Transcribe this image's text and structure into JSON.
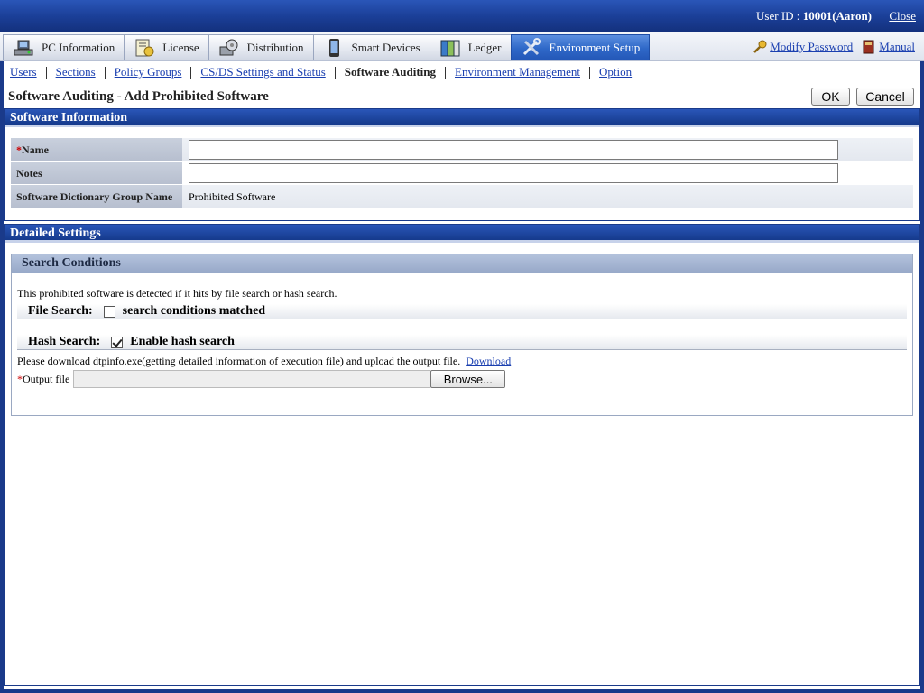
{
  "header": {
    "user_label": "User ID : ",
    "user_value": "10001(Aaron)",
    "close_label": "Close"
  },
  "tabs": [
    {
      "label": "PC Information",
      "icon": "pc-info-icon"
    },
    {
      "label": "License",
      "icon": "license-icon"
    },
    {
      "label": "Distribution",
      "icon": "distribution-icon"
    },
    {
      "label": "Smart Devices",
      "icon": "smart-device-icon"
    },
    {
      "label": "Ledger",
      "icon": "ledger-icon"
    },
    {
      "label": "Environment Setup",
      "icon": "tools-icon",
      "active": true
    }
  ],
  "top_links": {
    "modify_password": "Modify Password",
    "manual": "Manual"
  },
  "subnav": [
    {
      "label": "Users"
    },
    {
      "label": "Sections"
    },
    {
      "label": "Policy Groups"
    },
    {
      "label": "CS/DS Settings and Status"
    },
    {
      "label": "Software Auditing",
      "current": true
    },
    {
      "label": "Environment Management"
    },
    {
      "label": "Option"
    }
  ],
  "page": {
    "title": "Software Auditing - Add Prohibited Software",
    "ok_label": "OK",
    "cancel_label": "Cancel"
  },
  "software_info": {
    "heading": "Software Information",
    "name_required_mark": "*",
    "name_label": "Name",
    "name_value": "",
    "notes_label": "Notes",
    "notes_value": "",
    "group_label": "Software Dictionary Group Name",
    "group_value": "Prohibited Software"
  },
  "detailed": {
    "heading": "Detailed Settings",
    "search_heading": "Search Conditions",
    "description": "This prohibited software is detected if it hits by file search or hash search.",
    "file_search_label": "File Search:",
    "file_search_option": "search conditions matched",
    "file_search_checked": false,
    "hash_search_label": "Hash Search:",
    "hash_search_option": "Enable hash search",
    "hash_search_checked": true,
    "download_text": "Please download dtpinfo.exe(getting detailed information of execution file) and upload the output file.",
    "download_link": "Download",
    "output_required_mark": "*",
    "output_label": "Output file",
    "browse_label": "Browse..."
  },
  "colors": {
    "brand_blue": "#1a3a8a",
    "link_blue": "#1a3fb0",
    "required_red": "#cc0000"
  }
}
